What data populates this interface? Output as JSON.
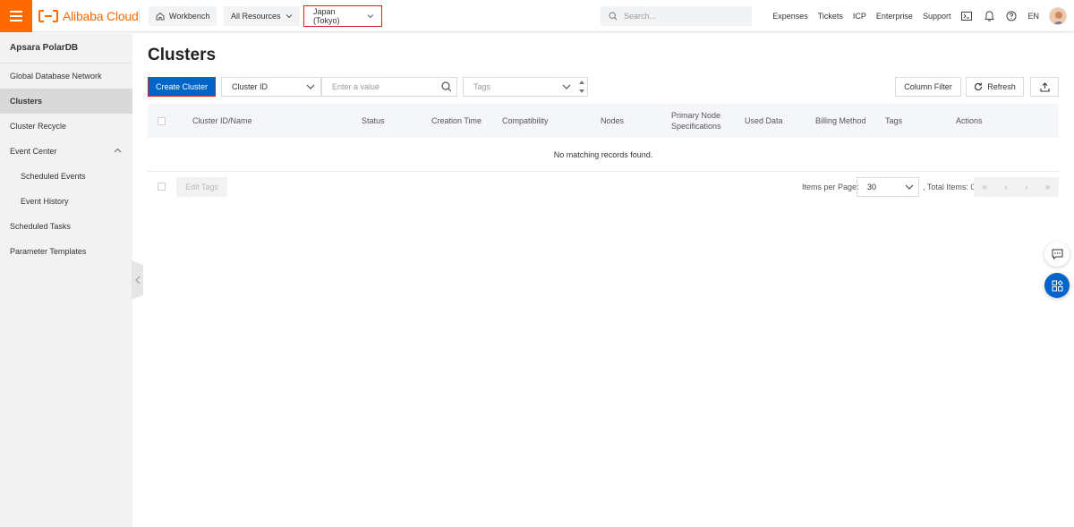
{
  "topbar": {
    "brand": "Alibaba Cloud",
    "workbench": "Workbench",
    "resources": "All Resources",
    "region": "Japan (Tokyo)",
    "search_placeholder": "Search...",
    "links": [
      "Expenses",
      "Tickets",
      "ICP",
      "Enterprise",
      "Support"
    ],
    "language": "EN",
    "icons": [
      "terminal-icon",
      "bell-icon",
      "help-icon"
    ]
  },
  "sidebar": {
    "product": "Apsara PolarDB",
    "items": [
      {
        "label": "Global Database Network"
      },
      {
        "label": "Clusters",
        "active": true
      },
      {
        "label": "Cluster Recycle"
      },
      {
        "label": "Event Center",
        "expanded": true
      },
      {
        "label": "Scheduled Events",
        "sub": true
      },
      {
        "label": "Event History",
        "sub": true
      },
      {
        "label": "Scheduled Tasks"
      },
      {
        "label": "Parameter Templates"
      }
    ]
  },
  "main": {
    "title": "Clusters",
    "create_button": "Create Cluster",
    "filter_field": "Cluster ID",
    "filter_placeholder": "Enter a value",
    "tags_placeholder": "Tags",
    "column_filter": "Column Filter",
    "refresh": "Refresh",
    "columns": [
      "Cluster ID/Name",
      "Status",
      "Creation Time",
      "Compatibility",
      "Nodes",
      "Primary Node\nSpecifications",
      "Used Data",
      "Billing Method",
      "Tags",
      "Actions"
    ],
    "empty_message": "No matching records found.",
    "edit_tags": "Edit Tags",
    "items_per_page_label": "Items per Page:",
    "items_per_page": "30",
    "total_items": ", Total Items: 0"
  },
  "colors": {
    "brand_orange": "#ff6a00",
    "primary_blue": "#0064c8",
    "highlight_red": "#e02020"
  }
}
